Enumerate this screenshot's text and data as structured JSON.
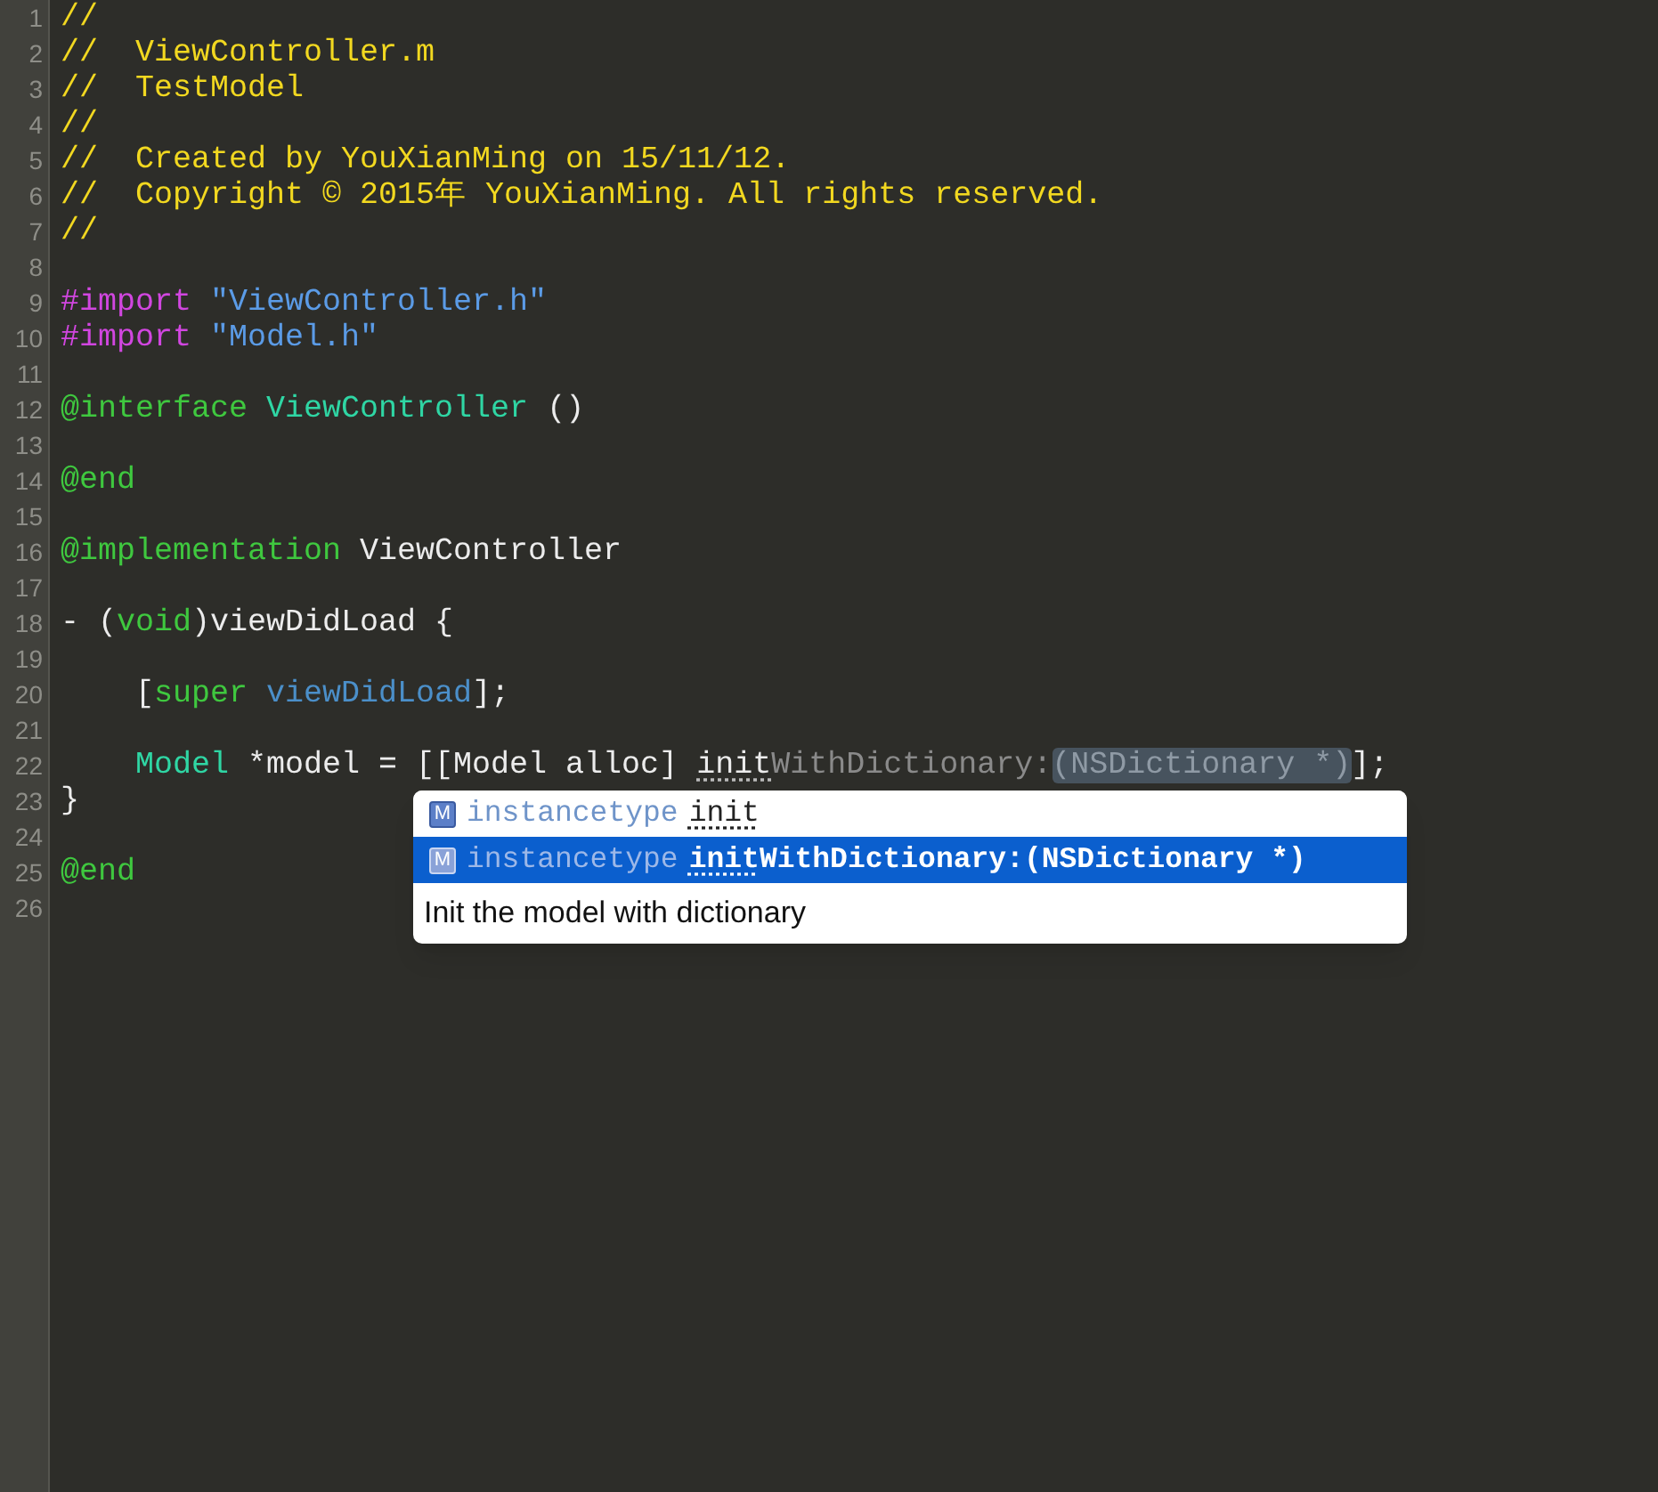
{
  "editor": {
    "lines": [
      {
        "number": "1",
        "tokens": [
          {
            "text": "//",
            "kind": "comment"
          }
        ]
      },
      {
        "number": "2",
        "tokens": [
          {
            "text": "//  ViewController.m",
            "kind": "comment"
          }
        ]
      },
      {
        "number": "3",
        "tokens": [
          {
            "text": "//  TestModel",
            "kind": "comment"
          }
        ]
      },
      {
        "number": "4",
        "tokens": [
          {
            "text": "//",
            "kind": "comment"
          }
        ]
      },
      {
        "number": "5",
        "tokens": [
          {
            "text": "//  Created by YouXianMing on 15/11/12.",
            "kind": "comment"
          }
        ]
      },
      {
        "number": "6",
        "tokens": [
          {
            "text": "//  Copyright © 2015年 YouXianMing. All rights reserved.",
            "kind": "comment"
          }
        ]
      },
      {
        "number": "7",
        "tokens": [
          {
            "text": "//",
            "kind": "comment"
          }
        ]
      },
      {
        "number": "8"
      },
      {
        "number": "9",
        "tokens": [
          {
            "text": "#import ",
            "kind": "preprocessor"
          },
          {
            "text": "\"ViewController.h\"",
            "kind": "string"
          }
        ]
      },
      {
        "number": "10",
        "tokens": [
          {
            "text": "#import ",
            "kind": "preprocessor"
          },
          {
            "text": "\"Model.h\"",
            "kind": "string"
          }
        ]
      },
      {
        "number": "11"
      },
      {
        "number": "12",
        "tokens": [
          {
            "text": "@interface ",
            "kind": "keyword"
          },
          {
            "text": "ViewController",
            "kind": "type"
          },
          {
            "text": " ()",
            "kind": "plain"
          }
        ]
      },
      {
        "number": "13"
      },
      {
        "number": "14",
        "tokens": [
          {
            "text": "@end",
            "kind": "keyword"
          }
        ]
      },
      {
        "number": "15"
      },
      {
        "number": "16",
        "tokens": [
          {
            "text": "@implementation",
            "kind": "keyword"
          },
          {
            "text": " ViewController",
            "kind": "plain"
          }
        ]
      },
      {
        "number": "17"
      },
      {
        "number": "18",
        "tokens": [
          {
            "text": "- (",
            "kind": "plain"
          },
          {
            "text": "void",
            "kind": "keyword"
          },
          {
            "text": ")viewDidLoad {",
            "kind": "plain"
          }
        ]
      },
      {
        "number": "19"
      },
      {
        "number": "20",
        "indented": true,
        "tokens": [
          {
            "text": "[",
            "kind": "plain"
          },
          {
            "text": "super ",
            "kind": "keyword"
          },
          {
            "text": "viewDidLoad",
            "kind": "method"
          },
          {
            "text": "];",
            "kind": "plain"
          }
        ]
      },
      {
        "number": "21"
      },
      {
        "number": "22",
        "indented": true,
        "tokens": [
          {
            "text": "Model",
            "kind": "type"
          },
          {
            "text": " *model = [[Model alloc] ",
            "kind": "plain"
          },
          {
            "text": "init",
            "kind": "typed"
          },
          {
            "text": "WithDictionary:",
            "kind": "preview"
          },
          {
            "text": "(NSDictionary *)",
            "kind": "placeholder"
          },
          {
            "text": "];",
            "kind": "plain"
          }
        ]
      },
      {
        "number": "23",
        "tokens": [
          {
            "text": "}",
            "kind": "plain"
          }
        ]
      },
      {
        "number": "24"
      },
      {
        "number": "25",
        "tokens": [
          {
            "text": "@end",
            "kind": "keyword"
          }
        ]
      },
      {
        "number": "26"
      }
    ]
  },
  "completion": {
    "items": [
      {
        "badge": "M",
        "return_type": "instancetype",
        "matched": "init",
        "selected": false
      },
      {
        "badge": "M",
        "return_type": "instancetype",
        "matched": "init",
        "rest": "WithDictionary:",
        "params": "(NSDictionary *)",
        "selected": true
      }
    ],
    "description": "Init the model with dictionary"
  }
}
